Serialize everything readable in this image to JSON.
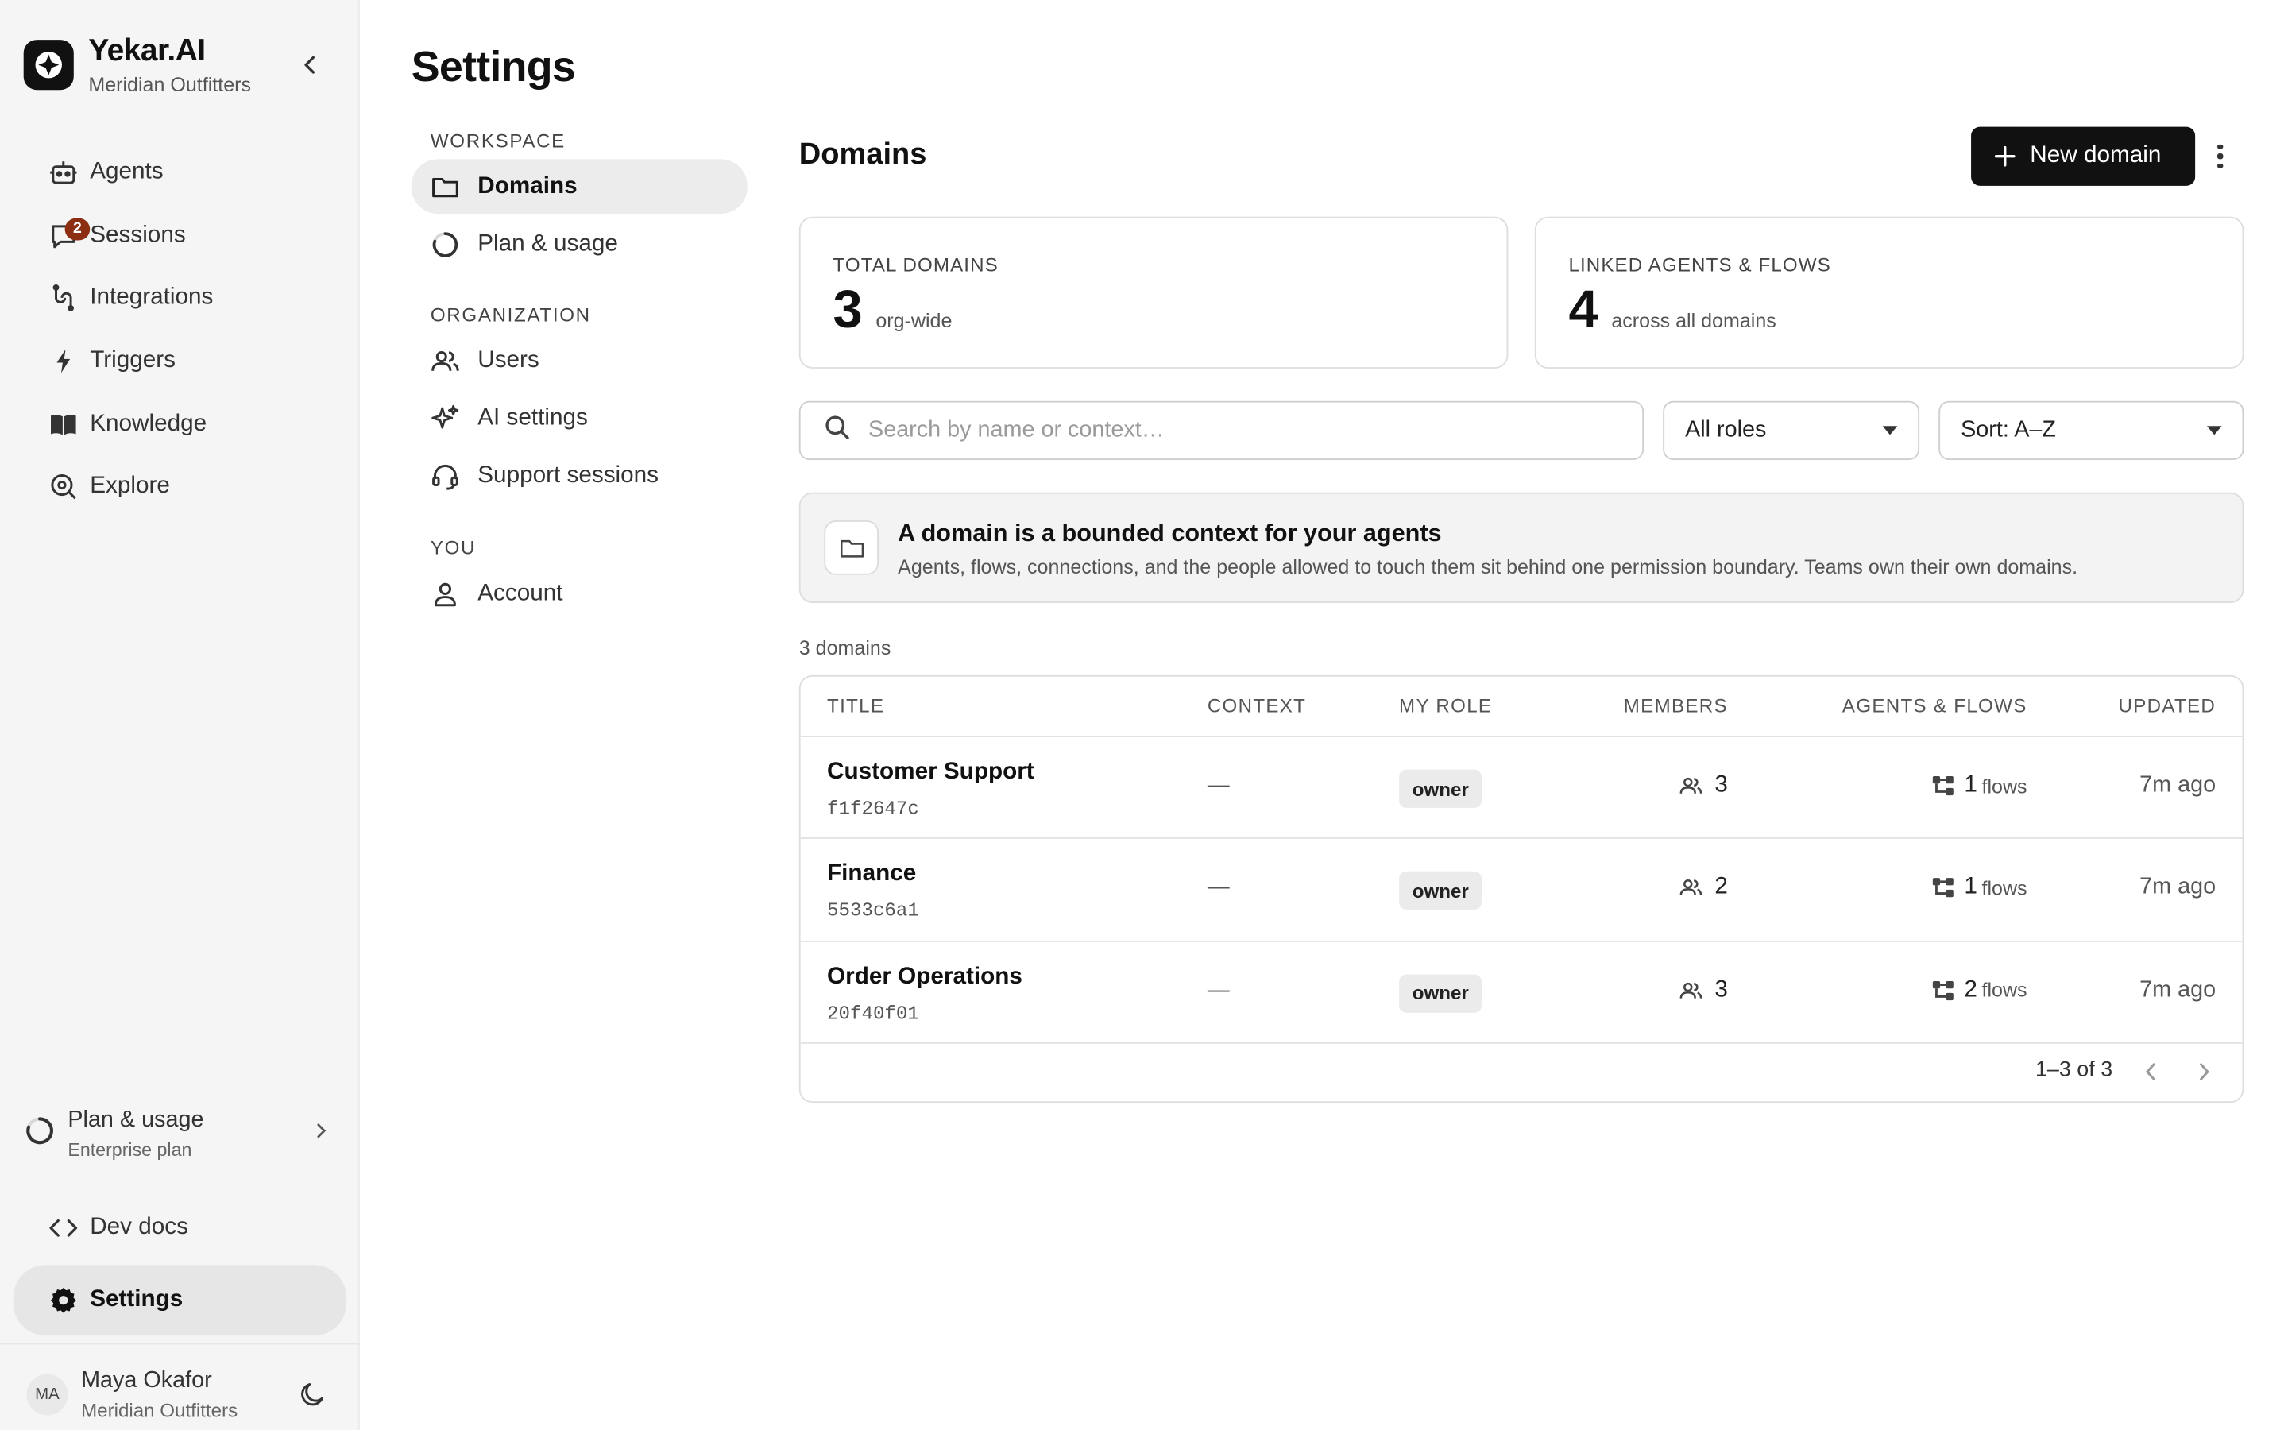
{
  "app": {
    "name": "Yekar.AI",
    "org": "Meridian Outfitters"
  },
  "sidebar": {
    "items": [
      {
        "label": "Agents",
        "icon": "robot-icon"
      },
      {
        "label": "Sessions",
        "icon": "chat-icon",
        "badge": "2"
      },
      {
        "label": "Integrations",
        "icon": "integrations-icon"
      },
      {
        "label": "Triggers",
        "icon": "bolt-icon"
      },
      {
        "label": "Knowledge",
        "icon": "book-icon"
      },
      {
        "label": "Explore",
        "icon": "explore-icon"
      }
    ],
    "plan": {
      "title": "Plan & usage",
      "subtitle": "Enterprise plan"
    },
    "devdocs": "Dev docs",
    "settings": "Settings",
    "user": {
      "initials": "MA",
      "name": "Maya Okafor",
      "org": "Meridian Outfitters"
    }
  },
  "settings": {
    "title": "Settings",
    "sections": {
      "workspace": "WORKSPACE",
      "organization": "ORGANIZATION",
      "you": "YOU"
    },
    "items": {
      "domains": "Domains",
      "plan": "Plan & usage",
      "users": "Users",
      "ai": "AI settings",
      "support": "Support sessions",
      "account": "Account"
    }
  },
  "main": {
    "title": "Domains",
    "new_button": "New domain",
    "stats": [
      {
        "label": "TOTAL DOMAINS",
        "value": "3",
        "sub": "org-wide"
      },
      {
        "label": "LINKED AGENTS & FLOWS",
        "value": "4",
        "sub": "across all domains"
      }
    ],
    "search_placeholder": "Search by name or context…",
    "role_filter": "All roles",
    "sort": "Sort: A–Z",
    "info": {
      "title": "A domain is a bounded context for your agents",
      "body": "Agents, flows, connections, and the people allowed to touch them sit behind one permission boundary. Teams own their own domains."
    },
    "count": "3 domains",
    "table": {
      "headers": [
        "TITLE",
        "CONTEXT",
        "MY ROLE",
        "MEMBERS",
        "AGENTS & FLOWS",
        "UPDATED"
      ],
      "rows": [
        {
          "title": "Customer Support",
          "id": "f1f2647c",
          "context": "—",
          "role": "owner",
          "members": "3",
          "flows": "1",
          "flows_unit": "flows",
          "updated": "7m ago"
        },
        {
          "title": "Finance",
          "id": "5533c6a1",
          "context": "—",
          "role": "owner",
          "members": "2",
          "flows": "1",
          "flows_unit": "flows",
          "updated": "7m ago"
        },
        {
          "title": "Order Operations",
          "id": "20f40f01",
          "context": "—",
          "role": "owner",
          "members": "3",
          "flows": "2",
          "flows_unit": "flows",
          "updated": "7m ago"
        }
      ],
      "pagination": "1–3 of 3"
    }
  },
  "colors": {
    "primary": "#111111",
    "badge": "#8b2e12",
    "sidebar_bg": "#f5f5f5"
  }
}
